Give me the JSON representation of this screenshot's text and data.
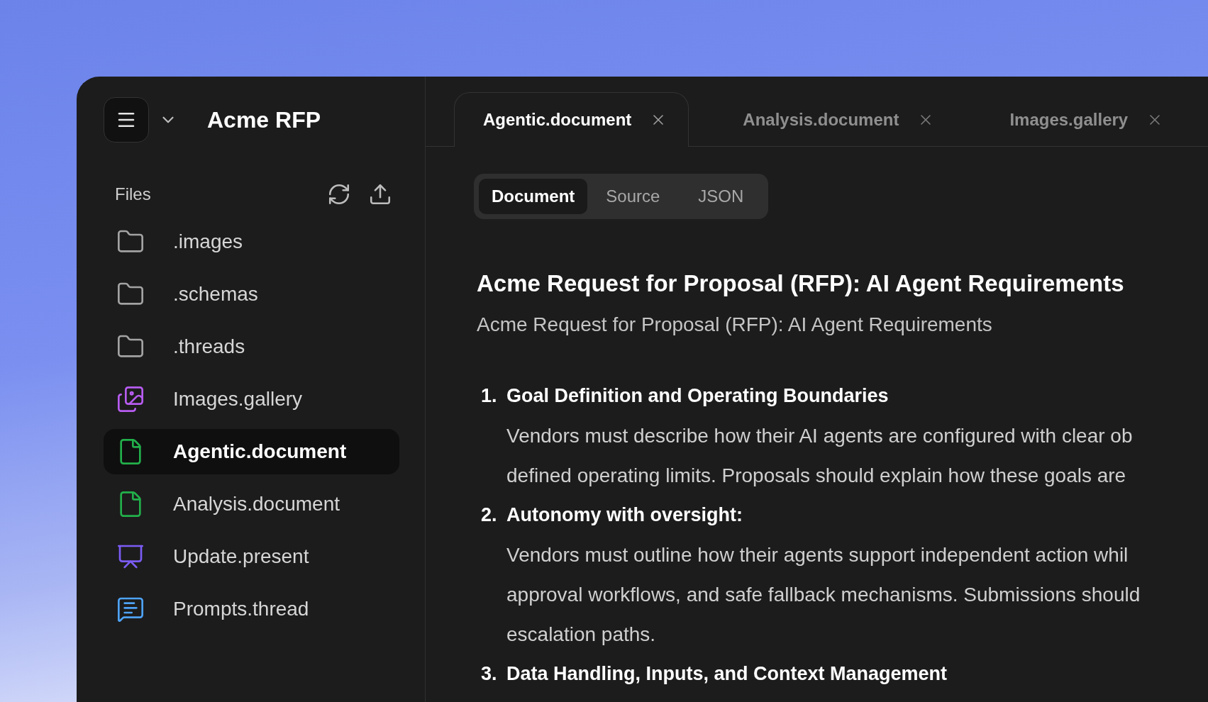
{
  "app": {
    "title": "Acme RFP"
  },
  "sidebar": {
    "section_label": "Files",
    "items": [
      {
        "name": ".images",
        "kind": "folder",
        "selected": false
      },
      {
        "name": ".schemas",
        "kind": "folder",
        "selected": false
      },
      {
        "name": ".threads",
        "kind": "folder",
        "selected": false
      },
      {
        "name": "Images.gallery",
        "kind": "gallery",
        "selected": false
      },
      {
        "name": "Agentic.document",
        "kind": "document",
        "selected": true
      },
      {
        "name": "Analysis.document",
        "kind": "document",
        "selected": false
      },
      {
        "name": "Update.present",
        "kind": "presentation",
        "selected": false
      },
      {
        "name": "Prompts.thread",
        "kind": "thread",
        "selected": false
      }
    ]
  },
  "tabs": [
    {
      "label": "Agentic.document",
      "selected": true
    },
    {
      "label": "Analysis.document",
      "selected": false
    },
    {
      "label": "Images.gallery",
      "selected": false
    }
  ],
  "view_modes": [
    {
      "label": "Document",
      "selected": true
    },
    {
      "label": "Source",
      "selected": false
    },
    {
      "label": "JSON",
      "selected": false
    }
  ],
  "document": {
    "title": "Acme Request for Proposal (RFP): AI Agent Requirements",
    "subtitle": "Acme Request for Proposal (RFP): AI Agent Requirements",
    "sections": [
      {
        "number": "1.",
        "heading": "Goal Definition and Operating Boundaries",
        "lines": [
          "Vendors must describe how their AI agents are configured with clear ob",
          "defined operating limits. Proposals should explain how these goals are"
        ]
      },
      {
        "number": "2.",
        "heading": "Autonomy with oversight:",
        "lines": [
          "Vendors must outline how their agents support independent action whil",
          "approval workflows, and safe fallback mechanisms. Submissions should",
          "escalation paths."
        ]
      },
      {
        "number": "3.",
        "heading": "Data Handling, Inputs, and Context Management"
      }
    ]
  }
}
